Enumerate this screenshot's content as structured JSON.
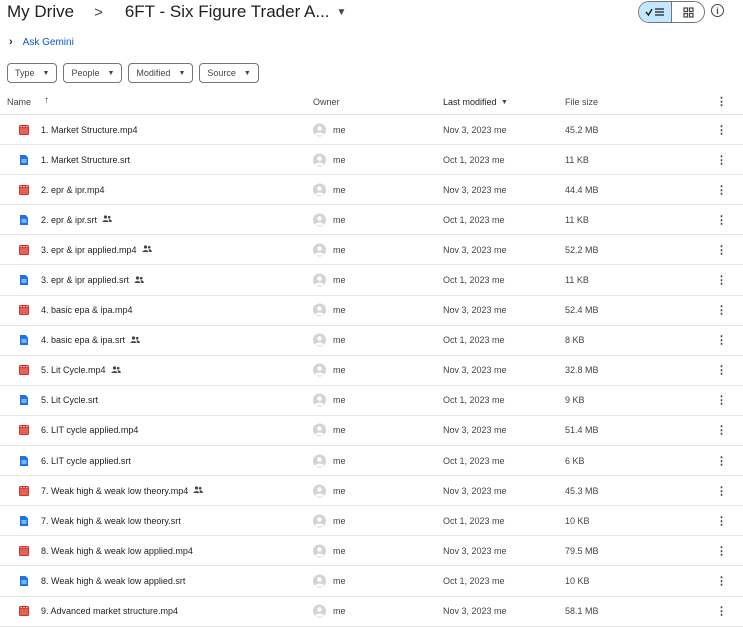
{
  "breadcrumb": {
    "root": "My Drive",
    "separator": ">",
    "current": "6FT - Six Figure Trader A..."
  },
  "toolbar": {
    "list_view_icon": "check-list-icon",
    "grid_view_icon": "grid-icon",
    "info_icon": "info-icon"
  },
  "gemini": {
    "label": "Ask Gemini"
  },
  "filters": [
    {
      "label": "Type"
    },
    {
      "label": "People"
    },
    {
      "label": "Modified"
    },
    {
      "label": "Source"
    }
  ],
  "columns": {
    "name": "Name",
    "owner": "Owner",
    "last_modified": "Last modified",
    "file_size": "File size"
  },
  "colors": {
    "video": "#d93025",
    "doc": "#1a73e8",
    "accent": "#0b57d0",
    "selected_toggle": "#c2e7ff"
  },
  "files": [
    {
      "name": "1. Market Structure.mp4",
      "type": "video",
      "shared": false,
      "owner": "me",
      "modified": "Nov 3, 2023 me",
      "size": "45.2 MB"
    },
    {
      "name": "1. Market Structure.srt",
      "type": "doc",
      "shared": false,
      "owner": "me",
      "modified": "Oct 1, 2023 me",
      "size": "11 KB"
    },
    {
      "name": "2. epr & ipr.mp4",
      "type": "video",
      "shared": false,
      "owner": "me",
      "modified": "Nov 3, 2023 me",
      "size": "44.4 MB"
    },
    {
      "name": "2. epr & ipr.srt",
      "type": "doc",
      "shared": true,
      "owner": "me",
      "modified": "Oct 1, 2023 me",
      "size": "11 KB"
    },
    {
      "name": "3. epr & ipr applied.mp4",
      "type": "video",
      "shared": true,
      "owner": "me",
      "modified": "Nov 3, 2023 me",
      "size": "52.2 MB"
    },
    {
      "name": "3. epr & ipr applied.srt",
      "type": "doc",
      "shared": true,
      "owner": "me",
      "modified": "Oct 1, 2023 me",
      "size": "11 KB"
    },
    {
      "name": "4. basic epa & ipa.mp4",
      "type": "video",
      "shared": false,
      "owner": "me",
      "modified": "Nov 3, 2023 me",
      "size": "52.4 MB"
    },
    {
      "name": "4. basic epa & ipa.srt",
      "type": "doc",
      "shared": true,
      "owner": "me",
      "modified": "Oct 1, 2023 me",
      "size": "8 KB"
    },
    {
      "name": "5. Lit Cycle.mp4",
      "type": "video",
      "shared": true,
      "owner": "me",
      "modified": "Nov 3, 2023 me",
      "size": "32.8 MB"
    },
    {
      "name": "5. Lit Cycle.srt",
      "type": "doc",
      "shared": false,
      "owner": "me",
      "modified": "Oct 1, 2023 me",
      "size": "9 KB"
    },
    {
      "name": "6. LIT cycle applied.mp4",
      "type": "video",
      "shared": false,
      "owner": "me",
      "modified": "Nov 3, 2023 me",
      "size": "51.4 MB"
    },
    {
      "name": "6. LIT cycle applied.srt",
      "type": "doc",
      "shared": false,
      "owner": "me",
      "modified": "Oct 1, 2023 me",
      "size": "6 KB"
    },
    {
      "name": "7. Weak high & weak low theory.mp4",
      "type": "video",
      "shared": true,
      "owner": "me",
      "modified": "Nov 3, 2023 me",
      "size": "45.3 MB"
    },
    {
      "name": "7. Weak high & weak low theory.srt",
      "type": "doc",
      "shared": false,
      "owner": "me",
      "modified": "Oct 1, 2023 me",
      "size": "10 KB"
    },
    {
      "name": "8. Weak high & weak low applied.mp4",
      "type": "video",
      "shared": false,
      "owner": "me",
      "modified": "Nov 3, 2023 me",
      "size": "79.5 MB"
    },
    {
      "name": "8. Weak high & weak low applied.srt",
      "type": "doc",
      "shared": false,
      "owner": "me",
      "modified": "Oct 1, 2023 me",
      "size": "10 KB"
    },
    {
      "name": "9. Advanced market structure.mp4",
      "type": "video",
      "shared": false,
      "owner": "me",
      "modified": "Nov 3, 2023 me",
      "size": "58.1 MB"
    }
  ]
}
